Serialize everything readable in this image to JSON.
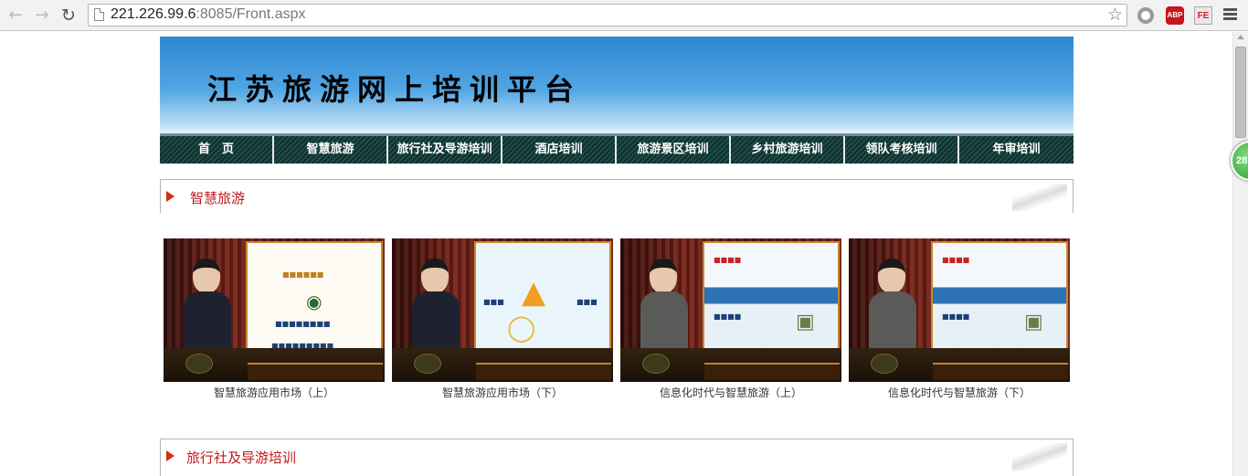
{
  "browser": {
    "url_host": "221.226.99.6",
    "url_rest": ":8085/Front.aspx",
    "extensions": [
      "ABP",
      "FE"
    ]
  },
  "badge": {
    "value": "28"
  },
  "site": {
    "title": "江苏旅游网上培训平台",
    "nav": [
      "首　页",
      "智慧旅游",
      "旅行社及导游培训",
      "酒店培训",
      "旅游景区培训",
      "乡村旅游培训",
      "领队考核培训",
      "年审培训"
    ]
  },
  "sections": [
    {
      "title": "智慧旅游",
      "videos": [
        {
          "label": "智慧旅游应用市场（上）"
        },
        {
          "label": "智慧旅游应用市场（下）"
        },
        {
          "label": "信息化时代与智慧旅游（上）"
        },
        {
          "label": "信息化时代与智慧旅游（下）"
        }
      ]
    },
    {
      "title": "旅行社及导游培训"
    }
  ],
  "colors": {
    "accent": "#c4171c",
    "nav_bg": "#1f4d4a",
    "header_top": "#2e86d1"
  }
}
